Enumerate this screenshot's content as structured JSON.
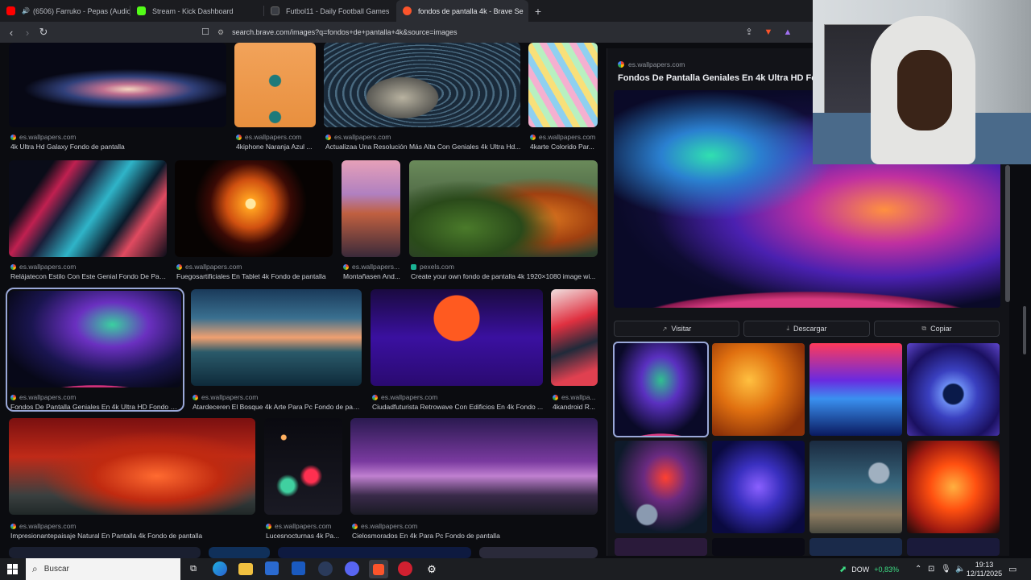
{
  "tabs": [
    {
      "label": "(6506) Farruko - Pepas (Audio) -",
      "icon_color": "#ff0000",
      "icon": "youtube-icon"
    },
    {
      "label": "Stream - Kick Dashboard",
      "icon_color": "#53fc18",
      "icon": "kick-icon"
    },
    {
      "label": "Futbol11 - Daily Football Games",
      "icon_color": "#3a3d44",
      "icon": "futbol11-icon"
    },
    {
      "label": "fondos de pantalla 4k - Brave Se",
      "icon_color": "#fb542b",
      "icon": "brave-search-icon"
    }
  ],
  "new_tab": "+",
  "url": "search.brave.com/images?q=fondos+de+pantalla+4k&source=images",
  "results": [
    {
      "source": "es.wallpapers.com",
      "caption": "4k Ultra Hd Galaxy Fondo de pantalla"
    },
    {
      "source": "es.wallpapers.com",
      "caption": "4kiphone Naranja Azul ..."
    },
    {
      "source": "es.wallpapers.com",
      "caption": "Actualizaa Una Resolución Más Alta Con Geniales 4k Ultra Hd..."
    },
    {
      "source": "es.wallpapers.com",
      "caption": "4karte Colorido Par..."
    },
    {
      "source": "es.wallpapers.com",
      "caption": "Relájatecon Estilo Con Este Genial Fondo De Pant..."
    },
    {
      "source": "es.wallpapers.com",
      "caption": "Fuegosartificiales En Tablet 4k Fondo de pantalla"
    },
    {
      "source": "es.wallpapers...",
      "caption": "Montañasen And..."
    },
    {
      "source": "pexels.com",
      "caption": "Create your own fondo de pantalla 4k 1920×1080 image wi..."
    },
    {
      "source": "es.wallpapers.com",
      "caption": "Fondos De Pantalla Geniales En 4k Ultra HD Fondo de ..."
    },
    {
      "source": "es.wallpapers.com",
      "caption": "Atardeceren El Bosque 4k Arte Para Pc Fondo de pant..."
    },
    {
      "source": "es.wallpapers.com",
      "caption": "Ciudadfuturista Retrowave Con Edificios En 4k Fondo ..."
    },
    {
      "source": "es.wallpa...",
      "caption": "4kandroid R..."
    },
    {
      "source": "es.wallpapers.com",
      "caption": "Impresionantepaisaje Natural En Pantalla 4k Fondo de pantalla"
    },
    {
      "source": "es.wallpapers.com",
      "caption": "Lucesnocturnas 4k Pa..."
    },
    {
      "source": "es.wallpapers.com",
      "caption": "Cielosmorados En 4k Para Pc Fondo de pantalla"
    }
  ],
  "preview": {
    "source": "es.wallpapers.com",
    "title": "Fondos De Pantalla Geniales En 4k Ultra HD Fon",
    "visit_label": "Visitar",
    "download_label": "Descargar",
    "copy_label": "Copiar"
  },
  "taskbar": {
    "search_placeholder": "Buscar",
    "stock_name": "DOW",
    "stock_change": "+0,83%",
    "time": "19:13",
    "date": "12/11/2025"
  },
  "colors": {
    "accent_green": "#3ddc84",
    "selection": "#9aa8d8"
  }
}
